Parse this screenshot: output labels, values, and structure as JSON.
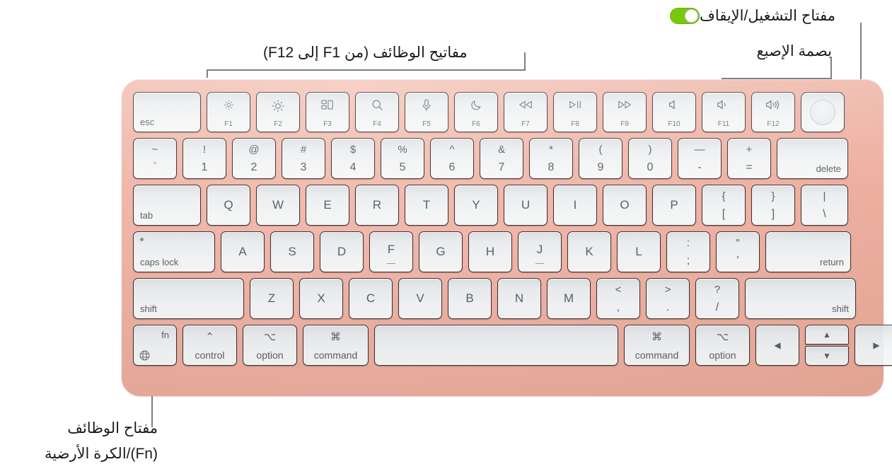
{
  "callouts": {
    "power": {
      "text": "مفتاح التشغيل/الإيقاف",
      "icon": "toggle-switch-on-icon",
      "accent": "#7ac70c"
    },
    "touch_id": {
      "text": "بصمة الإصبع"
    },
    "function_keys": {
      "text": "مفاتيح الوظائف (من F1 إلى F12)"
    },
    "fn_key": {
      "line1": "مفتاح الوظائف",
      "line2": "(Fn)/الكرة الأرضية"
    }
  },
  "keyboard": {
    "body_color": "#efb2a4",
    "key_color": "#f0f2f3",
    "legend_color": "#5d6063",
    "rows": {
      "function_row": [
        {
          "name": "esc",
          "label": "esc"
        },
        {
          "name": "f1",
          "fn": "F1",
          "icon": "brightness-down-icon"
        },
        {
          "name": "f2",
          "fn": "F2",
          "icon": "brightness-up-icon"
        },
        {
          "name": "f3",
          "fn": "F3",
          "icon": "mission-control-icon"
        },
        {
          "name": "f4",
          "fn": "F4",
          "icon": "spotlight-search-icon"
        },
        {
          "name": "f5",
          "fn": "F5",
          "icon": "dictation-microphone-icon"
        },
        {
          "name": "f6",
          "fn": "F6",
          "icon": "do-not-disturb-moon-icon"
        },
        {
          "name": "f7",
          "fn": "F7",
          "icon": "rewind-icon"
        },
        {
          "name": "f8",
          "fn": "F8",
          "icon": "play-pause-icon"
        },
        {
          "name": "f9",
          "fn": "F9",
          "icon": "fast-forward-icon"
        },
        {
          "name": "f10",
          "fn": "F10",
          "icon": "mute-icon"
        },
        {
          "name": "f11",
          "fn": "F11",
          "icon": "volume-down-icon"
        },
        {
          "name": "f12",
          "fn": "F12",
          "icon": "volume-up-icon"
        },
        {
          "name": "touch-id",
          "icon": "touch-id-icon"
        }
      ],
      "number_row": [
        {
          "name": "grave",
          "top": "~",
          "bottom": "`"
        },
        {
          "name": "1",
          "top": "!",
          "bottom": "1"
        },
        {
          "name": "2",
          "top": "@",
          "bottom": "2"
        },
        {
          "name": "3",
          "top": "#",
          "bottom": "3"
        },
        {
          "name": "4",
          "top": "$",
          "bottom": "4"
        },
        {
          "name": "5",
          "top": "%",
          "bottom": "5"
        },
        {
          "name": "6",
          "top": "^",
          "bottom": "6"
        },
        {
          "name": "7",
          "top": "&",
          "bottom": "7"
        },
        {
          "name": "8",
          "top": "*",
          "bottom": "8"
        },
        {
          "name": "9",
          "top": "(",
          "bottom": "9"
        },
        {
          "name": "0",
          "top": ")",
          "bottom": "0"
        },
        {
          "name": "minus",
          "top": "—",
          "bottom": "-"
        },
        {
          "name": "equal",
          "top": "+",
          "bottom": "="
        },
        {
          "name": "delete",
          "label": "delete"
        }
      ],
      "top_row": [
        {
          "name": "tab",
          "label": "tab"
        },
        {
          "name": "q",
          "letter": "Q"
        },
        {
          "name": "w",
          "letter": "W"
        },
        {
          "name": "e",
          "letter": "E"
        },
        {
          "name": "r",
          "letter": "R"
        },
        {
          "name": "t",
          "letter": "T"
        },
        {
          "name": "y",
          "letter": "Y"
        },
        {
          "name": "u",
          "letter": "U"
        },
        {
          "name": "i",
          "letter": "I"
        },
        {
          "name": "o",
          "letter": "O"
        },
        {
          "name": "p",
          "letter": "P"
        },
        {
          "name": "bracket-left",
          "top": "{",
          "bottom": "["
        },
        {
          "name": "bracket-right",
          "top": "}",
          "bottom": "]"
        },
        {
          "name": "backslash",
          "top": "|",
          "bottom": "\\"
        }
      ],
      "home_row": [
        {
          "name": "caps-lock",
          "label": "caps lock",
          "led": true
        },
        {
          "name": "a",
          "letter": "A"
        },
        {
          "name": "s",
          "letter": "S"
        },
        {
          "name": "d",
          "letter": "D"
        },
        {
          "name": "f",
          "letter": "F",
          "homing": true
        },
        {
          "name": "g",
          "letter": "G"
        },
        {
          "name": "h",
          "letter": "H"
        },
        {
          "name": "j",
          "letter": "J",
          "homing": true
        },
        {
          "name": "k",
          "letter": "K"
        },
        {
          "name": "l",
          "letter": "L"
        },
        {
          "name": "semicolon",
          "top": ":",
          "bottom": ";"
        },
        {
          "name": "quote",
          "top": "\"",
          "bottom": "'"
        },
        {
          "name": "return",
          "label": "return"
        }
      ],
      "bottom_row": [
        {
          "name": "shift-left",
          "label": "shift"
        },
        {
          "name": "z",
          "letter": "Z"
        },
        {
          "name": "x",
          "letter": "X"
        },
        {
          "name": "c",
          "letter": "C"
        },
        {
          "name": "v",
          "letter": "V"
        },
        {
          "name": "b",
          "letter": "B"
        },
        {
          "name": "n",
          "letter": "N"
        },
        {
          "name": "m",
          "letter": "M"
        },
        {
          "name": "comma",
          "top": "<",
          "bottom": ","
        },
        {
          "name": "period",
          "top": ">",
          "bottom": "."
        },
        {
          "name": "slash",
          "top": "?",
          "bottom": "/"
        },
        {
          "name": "shift-right",
          "label": "shift"
        }
      ],
      "modifier_row": [
        {
          "name": "fn",
          "label": "fn",
          "icon": "globe-icon"
        },
        {
          "name": "control-left",
          "label": "control",
          "symbol": "⌃"
        },
        {
          "name": "option-left",
          "label": "option",
          "symbol": "⌥"
        },
        {
          "name": "command-left",
          "label": "command",
          "symbol": "⌘"
        },
        {
          "name": "space",
          "label": ""
        },
        {
          "name": "command-right",
          "label": "command",
          "symbol": "⌘"
        },
        {
          "name": "option-right",
          "label": "option",
          "symbol": "⌥"
        },
        {
          "name": "arrow-left",
          "icon": "arrow-left-icon"
        },
        {
          "name": "arrow-up-down",
          "icon_up": "arrow-up-icon",
          "icon_down": "arrow-down-icon"
        },
        {
          "name": "arrow-right",
          "icon": "arrow-right-icon"
        }
      ]
    }
  }
}
